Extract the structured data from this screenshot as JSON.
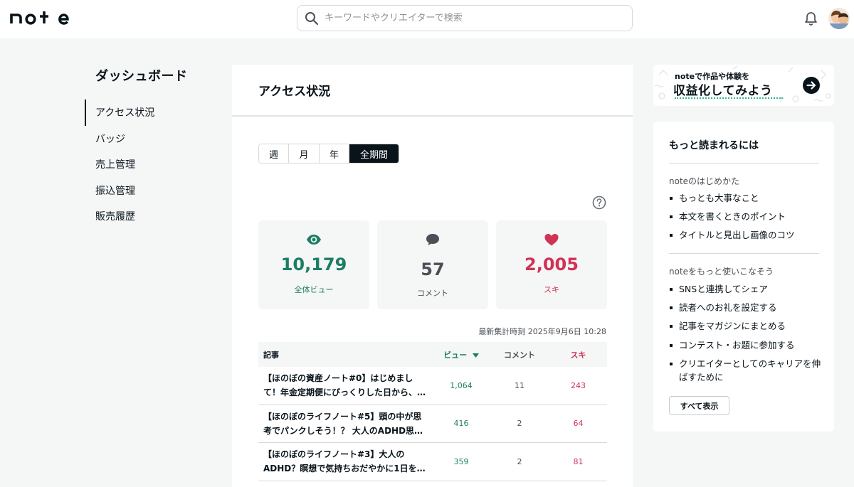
{
  "header": {
    "logo": "note",
    "search_placeholder": "キーワードやクリエイターで検索",
    "notification_icon": "bell-icon",
    "avatar_icon": "avatar"
  },
  "sidebar": {
    "title": "ダッシュボード",
    "items": [
      {
        "label": "アクセス状況",
        "active": true
      },
      {
        "label": "バッジ",
        "active": false
      },
      {
        "label": "売上管理",
        "active": false
      },
      {
        "label": "振込管理",
        "active": false
      },
      {
        "label": "販売履歴",
        "active": false
      }
    ]
  },
  "main": {
    "title": "アクセス状況",
    "periods": [
      {
        "label": "週",
        "active": false
      },
      {
        "label": "月",
        "active": false
      },
      {
        "label": "年",
        "active": false
      },
      {
        "label": "全期間",
        "active": true
      }
    ],
    "stats": {
      "views": {
        "value": "10,179",
        "label": "全体ビュー",
        "icon": "eye-icon",
        "color": "#1d7d64"
      },
      "comments": {
        "value": "57",
        "label": "コメント",
        "icon": "comment-icon",
        "color": "#4a5056"
      },
      "likes": {
        "value": "2,005",
        "label": "スキ",
        "icon": "heart-icon",
        "color": "#cf3355"
      }
    },
    "updated": "最新集計時刻 2025年9月6日 10:28",
    "table": {
      "headers": {
        "article": "記事",
        "views": "ビュー",
        "comments": "コメント",
        "likes": "スキ"
      },
      "rows": [
        {
          "title": "【ほのぼの資産ノート#0】はじめまして！年金定期便にびっくりした日から、僕…",
          "views": "1,064",
          "comments": "11",
          "likes": "243"
        },
        {
          "title": "【ほのぼのライフノート#5】頭の中が思考でパンクしそう！？ 大人のADHD思…",
          "views": "416",
          "comments": "2",
          "likes": "64"
        },
        {
          "title": "【ほのぼのライフノート#3】大人のADHD？瞑想で気持ちおだやかに1日を始…",
          "views": "359",
          "comments": "2",
          "likes": "81"
        }
      ]
    }
  },
  "banner": {
    "small": "noteで作品や体験を",
    "big": "収益化してみよう"
  },
  "tips": {
    "title": "もっと読まれるには",
    "sections": [
      {
        "heading": "noteのはじめかた",
        "items": [
          "もっとも大事なこと",
          "本文を書くときのポイント",
          "タイトルと見出し画像のコツ"
        ]
      },
      {
        "heading": "noteをもっと使いこなそう",
        "items": [
          "SNSと連携してシェア",
          "読者へのお礼を設定する",
          "記事をマガジンにまとめる",
          "コンテスト・お題に参加する",
          "クリエイターとしてのキャリアを伸ばすために"
        ]
      }
    ],
    "show_all": "すべて表示"
  },
  "colors": {
    "views": "#1d7d64",
    "likes": "#cf3355",
    "text": "#08131a",
    "accent_dots": "#2cb696"
  }
}
